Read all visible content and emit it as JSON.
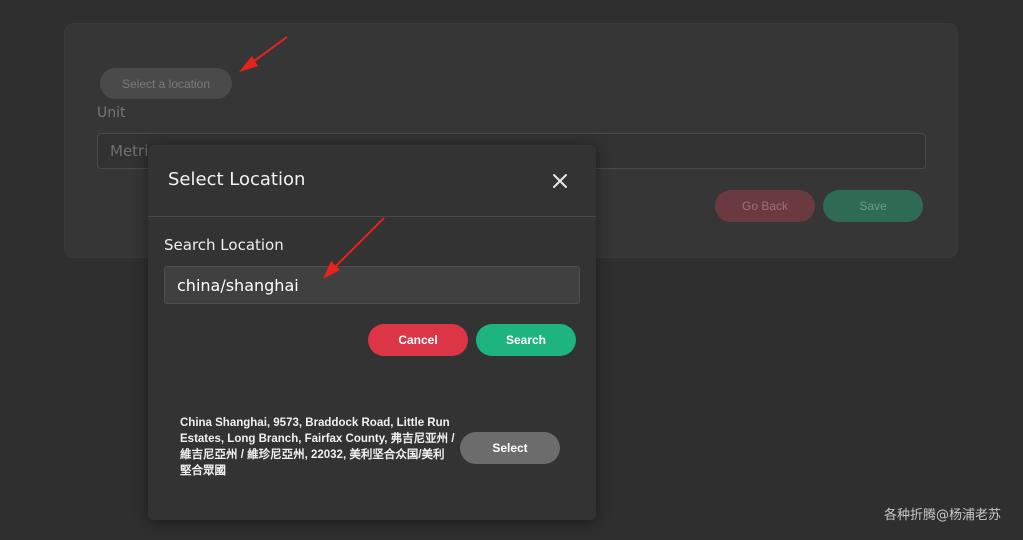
{
  "background": {
    "select_location_label": "Select a location",
    "unit_label": "Unit",
    "unit_value": "Metric",
    "go_back_label": "Go Back",
    "save_label": "Save"
  },
  "modal": {
    "title": "Select Location",
    "close_icon": "close-icon",
    "search_label": "Search Location",
    "search_value": "china/shanghai",
    "cancel_label": "Cancel",
    "search_button_label": "Search",
    "results": [
      {
        "address": "China Shanghai, 9573, Braddock Road, Little Run Estates, Long Branch, Fairfax County, 弗吉尼亚州 / 維吉尼亞州 / 維珍尼亞州, 22032, 美利坚合众国/美利堅合眾國",
        "select_label": "Select"
      }
    ]
  },
  "watermark": "各种折腾@杨浦老苏",
  "colors": {
    "cancel": "#dc3545",
    "search": "#1db47f",
    "arrow": "#e8231c"
  }
}
